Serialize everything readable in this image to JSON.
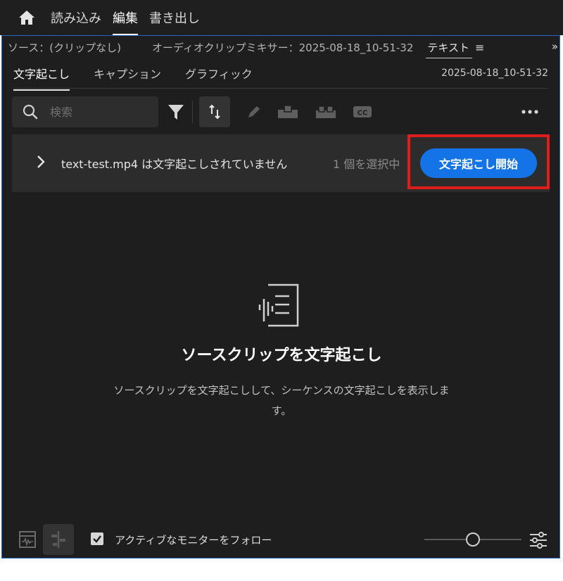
{
  "topnav": {
    "items": [
      {
        "label": "読み込み",
        "active": false
      },
      {
        "label": "編集",
        "active": true
      },
      {
        "label": "書き出し",
        "active": false
      }
    ]
  },
  "panelbar": {
    "source": "ソース：(クリップなし)",
    "mixer": "オーディオクリップミキサー：2025-08-18_10-51-32",
    "text_tab": "テキスト",
    "menu": "≡",
    "overflow": "»"
  },
  "subtabs": {
    "items": [
      {
        "label": "文字起こし",
        "active": true
      },
      {
        "label": "キャプション",
        "active": false
      },
      {
        "label": "グラフィック",
        "active": false
      }
    ],
    "sequence": "2025-08-18_10-51-32"
  },
  "search": {
    "placeholder": "検索"
  },
  "toolbar": {
    "icons": [
      "search-icon",
      "filter-icon",
      "sync-icon",
      "pencil-icon",
      "speaker-icon",
      "merge-speaker-icon",
      "cc-icon",
      "more-icon"
    ]
  },
  "notice": {
    "message": "text-test.mp4 は文字起こしされていません",
    "count": "1 個を選択中",
    "start_button": "文字起こし開始",
    "highlight_color": "#e01d1d",
    "button_color": "#1473e6"
  },
  "empty": {
    "title": "ソースクリップを文字起こし",
    "description": "ソースクリップを文字起こしして、シーケンスの文字起こしを表示します。"
  },
  "footer": {
    "follow_label": "アクティブなモニターをフォロー",
    "follow_checked": true,
    "zoom_level": 0.5
  },
  "colors": {
    "accent": "#1473e6",
    "panel": "#1e1e1e",
    "panel_border": "#2a64c4"
  }
}
